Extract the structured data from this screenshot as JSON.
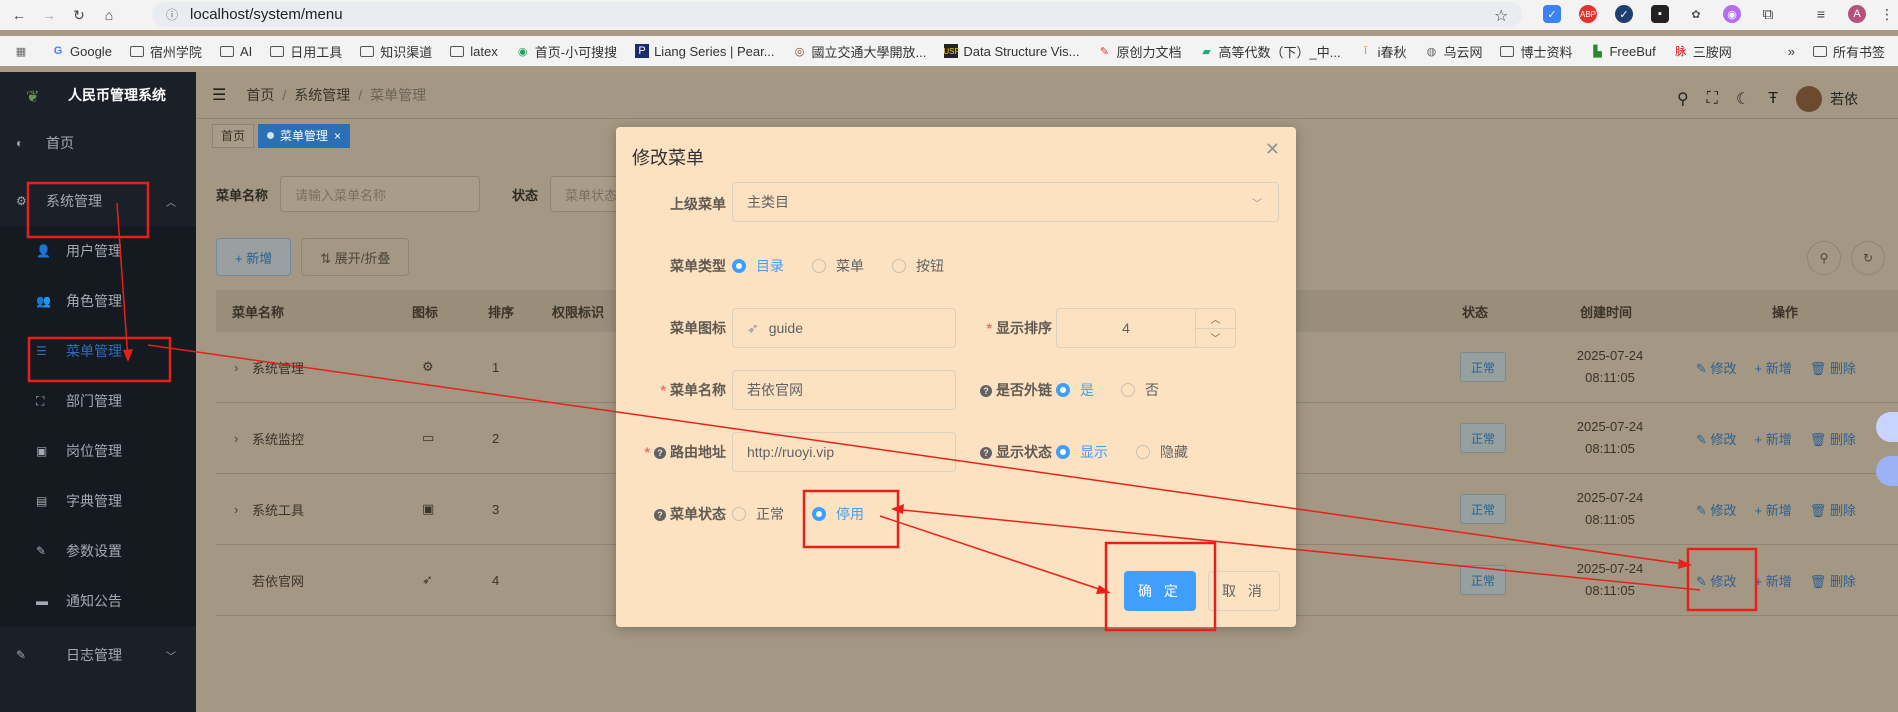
{
  "browser": {
    "url": "localhost/system/menu",
    "bookmarks": [
      "Google",
      "宿州学院",
      "AI",
      "日用工具",
      "知识渠道",
      "latex",
      "首页-小可搜搜",
      "Liang Series | Pear...",
      "國立交通大學開放...",
      "Data Structure Vis...",
      "原创力文档",
      "高等代数（下）_中...",
      "i春秋",
      "乌云网",
      "博士资料",
      "FreeBuf",
      "三胺网"
    ],
    "bookmarks_more": "»",
    "bookmarks_all": "所有书签"
  },
  "sidebar": {
    "app_title": "人民币管理系统",
    "home": "首页",
    "system": "系统管理",
    "sub_items": [
      "用户管理",
      "角色管理",
      "菜单管理",
      "部门管理",
      "岗位管理",
      "字典管理",
      "参数设置",
      "通知公告"
    ],
    "log": "日志管理"
  },
  "navbar": {
    "breadcrumb": [
      "首页",
      "系统管理",
      "菜单管理"
    ],
    "user": "若依"
  },
  "tags": [
    "首页",
    "菜单管理"
  ],
  "filters": {
    "name_label": "菜单名称",
    "name_placeholder": "请输入菜单名称",
    "status_label": "状态",
    "status_placeholder": "菜单状态"
  },
  "actions": {
    "add": "+ 新增",
    "expand": "⇅ 展开/折叠"
  },
  "table": {
    "headers": [
      "菜单名称",
      "图标",
      "排序",
      "权限标识",
      "状态",
      "创建时间",
      "操作"
    ],
    "rows": [
      {
        "name": "系统管理",
        "order": "1",
        "status": "正常",
        "date": "2025-07-24",
        "time": "08:11:05",
        "has_children": true
      },
      {
        "name": "系统监控",
        "order": "2",
        "status": "正常",
        "date": "2025-07-24",
        "time": "08:11:05",
        "has_children": true
      },
      {
        "name": "系统工具",
        "order": "3",
        "status": "正常",
        "date": "2025-07-24",
        "time": "08:11:05",
        "has_children": true
      },
      {
        "name": "若依官网",
        "order": "4",
        "status": "正常",
        "date": "2025-07-24",
        "time": "08:11:05",
        "has_children": false
      }
    ],
    "op_edit": "修改",
    "op_add": "新增",
    "op_delete": "删除"
  },
  "dialog": {
    "title": "修改菜单",
    "parent_label": "上级菜单",
    "parent_value": "主类目",
    "type_label": "菜单类型",
    "type_options": [
      "目录",
      "菜单",
      "按钮"
    ],
    "type_selected": "目录",
    "icon_label": "菜单图标",
    "icon_value": "guide",
    "order_label": "显示排序",
    "order_value": "4",
    "name_label": "菜单名称",
    "name_value": "若依官网",
    "external_label": "是否外链",
    "external_options": [
      "是",
      "否"
    ],
    "external_selected": "是",
    "path_label": "路由地址",
    "path_value": "http://ruoyi.vip",
    "visible_label": "显示状态",
    "visible_options": [
      "显示",
      "隐藏"
    ],
    "visible_selected": "显示",
    "status_label": "菜单状态",
    "status_options": [
      "正常",
      "停用"
    ],
    "status_selected": "停用",
    "ok": "确 定",
    "cancel": "取 消"
  },
  "annotation_color": "#e8201a"
}
